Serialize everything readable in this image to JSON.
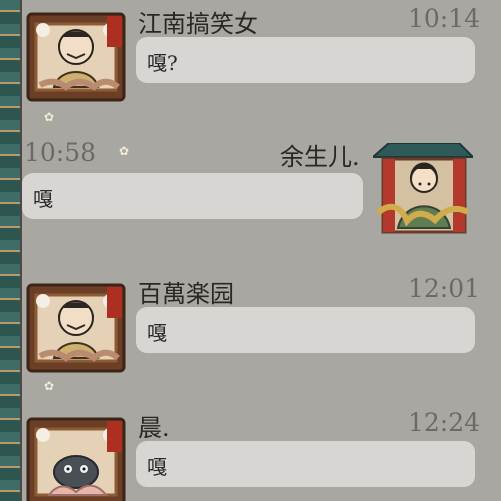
{
  "messages": [
    {
      "name": "江南搞笑女",
      "time": "10:14",
      "text": "嘎?",
      "side": "left",
      "avatar_icon": "character-avatar-framed"
    },
    {
      "name": "余生儿.",
      "time": "10:58",
      "text": "嘎",
      "side": "right",
      "avatar_icon": "character-avatar-pavilion"
    },
    {
      "name": "百萬楽园",
      "time": "12:01",
      "text": "嘎",
      "side": "left",
      "avatar_icon": "character-avatar-framed"
    },
    {
      "name": "晨.",
      "time": "12:24",
      "text": "嘎",
      "side": "left",
      "avatar_icon": "character-avatar-framed-animal"
    }
  ],
  "colors": {
    "background": "#a8a7a1",
    "bubble": "#d8d6d2",
    "frame": "#3f6c66",
    "name_text": "#2a2725",
    "time_text": "#6c6a66"
  }
}
